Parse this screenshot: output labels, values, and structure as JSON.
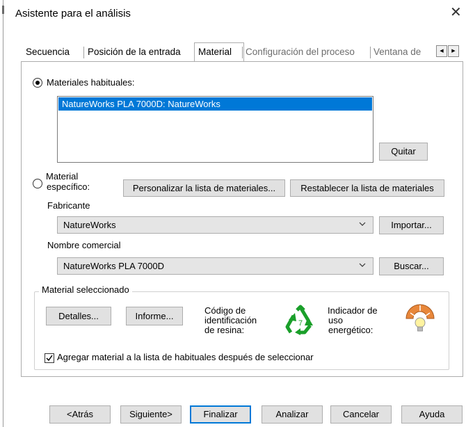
{
  "window": {
    "title": "Asistente para el análisis",
    "close_glyph": "✕"
  },
  "tabs": [
    {
      "label": "Secuencia",
      "state": "normal"
    },
    {
      "label": "Posición de la entrada",
      "state": "normal"
    },
    {
      "label": "Material",
      "state": "active"
    },
    {
      "label": "Configuración del proceso",
      "state": "disabled"
    },
    {
      "label": "Ventana de",
      "state": "disabled"
    }
  ],
  "tab_scroll": {
    "left_glyph": "◀",
    "right_glyph": "▶"
  },
  "common_materials": {
    "radio_label": "Materiales habituales:",
    "selected": true,
    "items": [
      "NatureWorks PLA 7000D: NatureWorks"
    ],
    "remove_button": "Quitar"
  },
  "specific_material": {
    "radio_label_line1": "Material",
    "radio_label_line2": "específico:",
    "selected": false,
    "customize_button": "Personalizar la lista de materiales...",
    "reset_button": "Restablecer la lista de materiales",
    "manufacturer_label": "Fabricante",
    "manufacturer_value": "NatureWorks",
    "import_button": "Importar...",
    "trade_name_label": "Nombre comercial",
    "trade_name_value": "NatureWorks PLA 7000D",
    "search_button": "Buscar..."
  },
  "selected_material": {
    "group_label": "Material seleccionado",
    "details_button": "Detalles...",
    "report_button": "Informe...",
    "resin_code_line1": "Código de",
    "resin_code_line2": "identificación",
    "resin_code_line3": "de resina:",
    "resin_code_number": "7",
    "energy_line1": "Indicador de",
    "energy_line2": "uso",
    "energy_line3": "energético:",
    "add_checkbox_label": "Agregar material a la lista de habituales después de seleccionar",
    "add_checkbox_checked": true,
    "recycle_color": "#1a9f2a",
    "energy_colors": [
      "#e8873a",
      "#f0b84a"
    ]
  },
  "footer": {
    "back": "<Atrás",
    "next": "Siguiente>",
    "finish": "Finalizar",
    "analyze": "Analizar",
    "cancel": "Cancelar",
    "help": "Ayuda"
  }
}
